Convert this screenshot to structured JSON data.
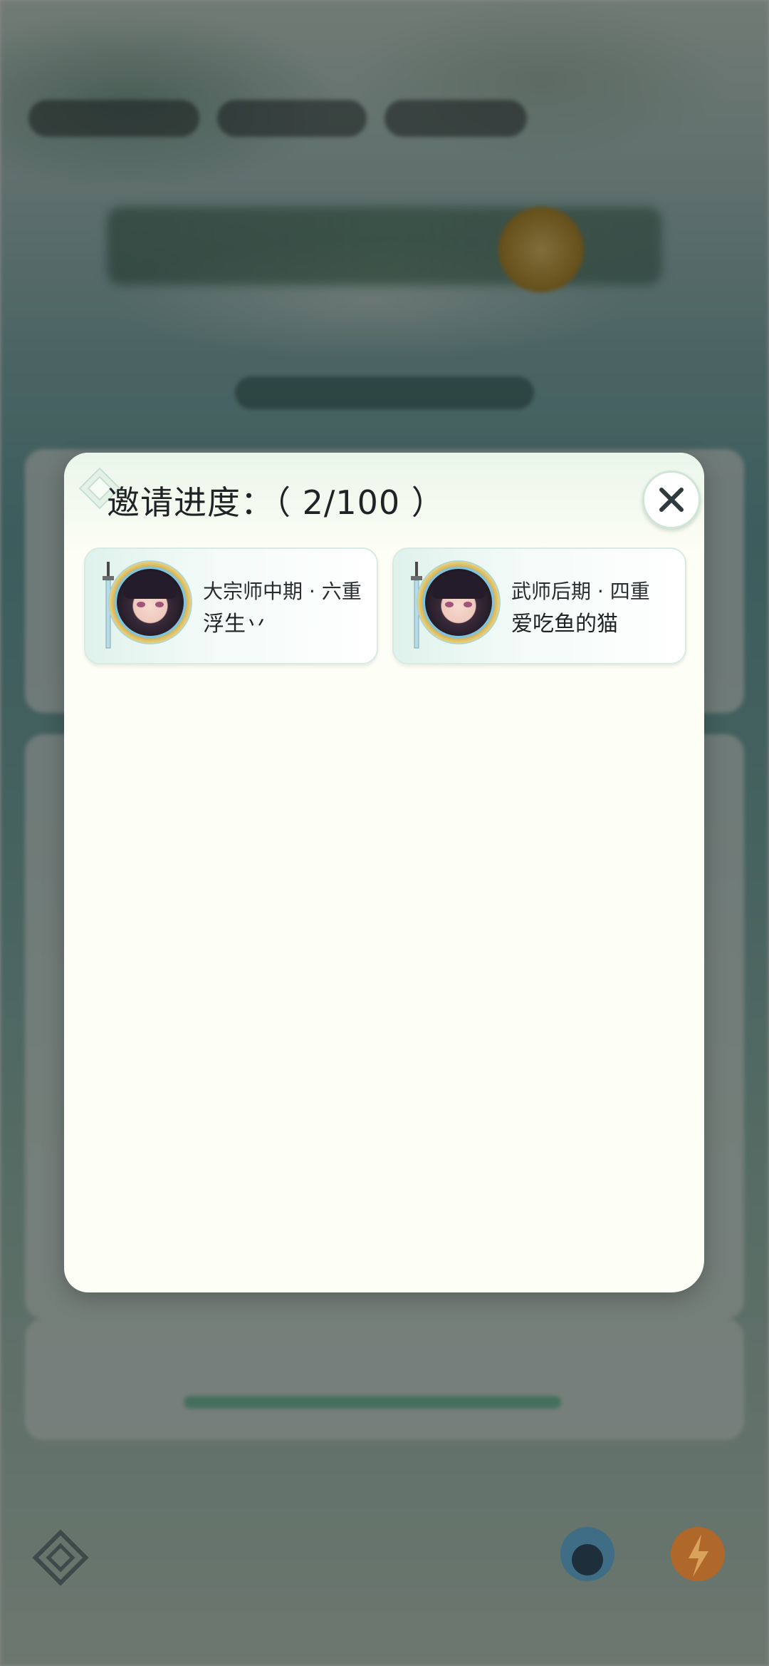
{
  "modal": {
    "title": "邀请进度：（ 2/100 ）",
    "close_icon": "close-icon"
  },
  "friends": [
    {
      "rank": "大宗师中期 · 六重",
      "name": "浮生丷"
    },
    {
      "rank": "武师后期 · 四重",
      "name": "爱吃鱼的猫"
    }
  ],
  "invite_progress": {
    "current": 2,
    "total": 100
  },
  "colors": {
    "modal_bg": "#fdfef5",
    "close_x": "#2f3a3e",
    "card_gradient_start": "#dff2ec"
  }
}
